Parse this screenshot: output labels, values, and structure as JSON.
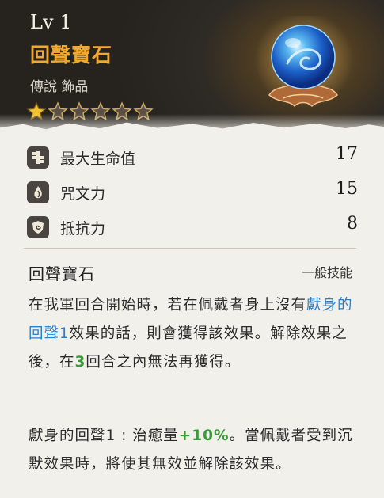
{
  "item": {
    "level": "Lv 1",
    "name": "回聲寶石",
    "type": "傳說 飾品",
    "stars": 6,
    "stars_filled": 1
  },
  "stats": [
    {
      "icon": "cross-plus-icon",
      "label": "最大生命值",
      "value": "17"
    },
    {
      "icon": "flame-leaf-icon",
      "label": "咒文力",
      "value": "15"
    },
    {
      "icon": "swirl-shield-icon",
      "label": "抵抗力",
      "value": "8"
    }
  ],
  "skill": {
    "title": "回聲寶石",
    "category": "一般技能",
    "desc1": {
      "p1": "在我軍回合開始時，若在佩戴者身上沒有",
      "highlight": "獻身的回聲1",
      "p2": "效果的話，則會獲得該效果。解除效果之後，在",
      "num": "3",
      "p3": "回合之內無法再獲得。"
    },
    "desc2": {
      "p1": "獻身的回聲1 : 治癒量",
      "pct": "+10%",
      "p2": "。當佩戴者受到沉默效果時，將使其無效並解除該效果。"
    }
  },
  "colors": {
    "name": "#f0a830",
    "highlight_blue": "#2f7fc4",
    "highlight_green": "#3a9a3a",
    "header_bg": "#2a2622"
  }
}
